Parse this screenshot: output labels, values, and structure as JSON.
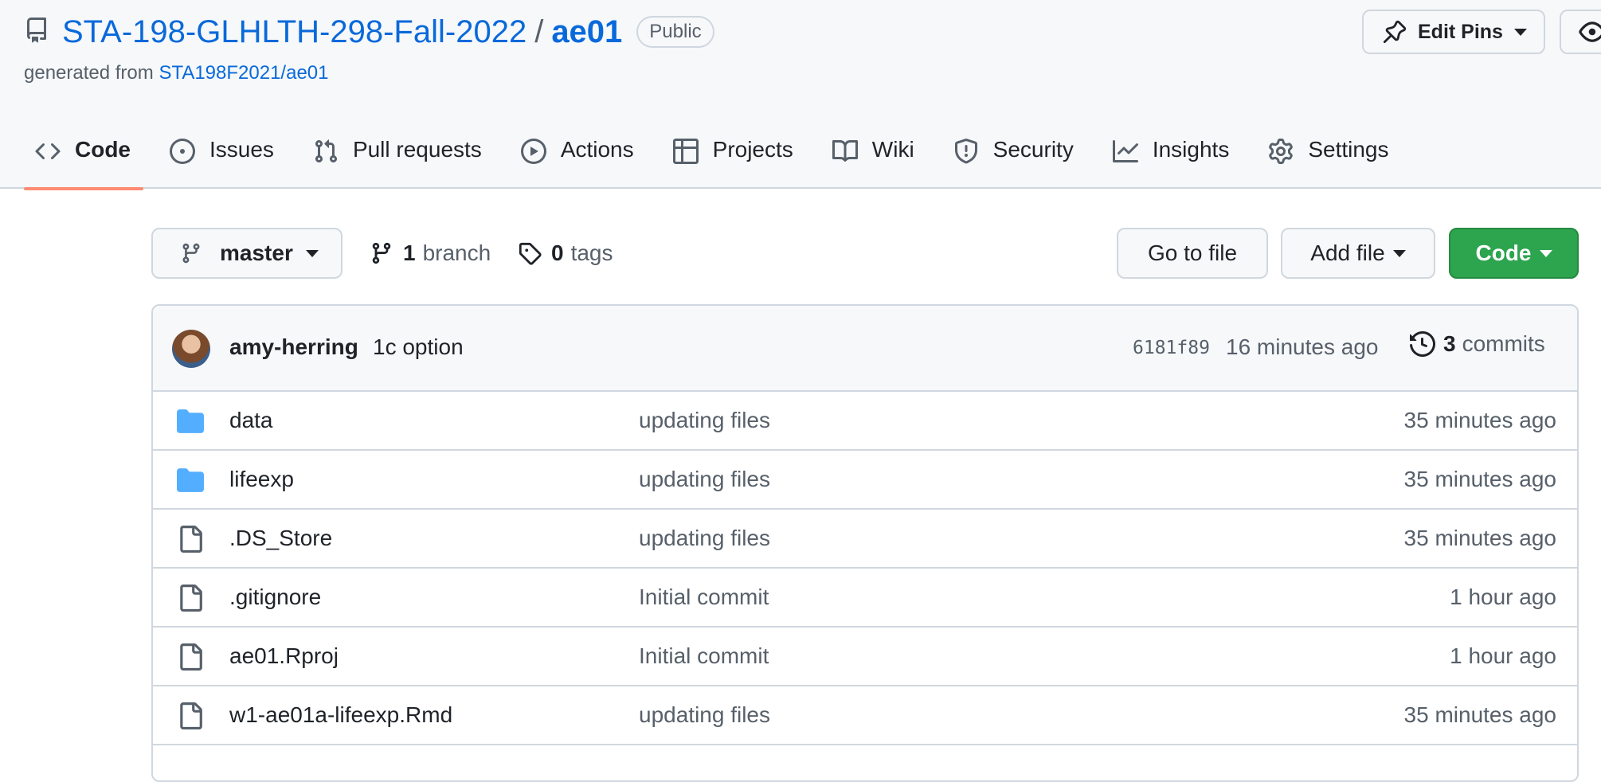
{
  "repo": {
    "owner": "STA-198-GLHLTH-298-Fall-2022",
    "separator": "/",
    "name": "ae01",
    "visibility": "Public",
    "generated_prefix": "generated from",
    "template_link": "STA198F2021/ae01"
  },
  "header_actions": {
    "edit_pins": "Edit Pins"
  },
  "tabs": [
    {
      "label": "Code",
      "icon": "code-icon",
      "active": true
    },
    {
      "label": "Issues",
      "icon": "issue-icon"
    },
    {
      "label": "Pull requests",
      "icon": "pull-request-icon"
    },
    {
      "label": "Actions",
      "icon": "play-icon"
    },
    {
      "label": "Projects",
      "icon": "table-icon"
    },
    {
      "label": "Wiki",
      "icon": "book-icon"
    },
    {
      "label": "Security",
      "icon": "shield-icon"
    },
    {
      "label": "Insights",
      "icon": "graph-icon"
    },
    {
      "label": "Settings",
      "icon": "gear-icon"
    }
  ],
  "toolbar": {
    "branch": "master",
    "branch_count": "1",
    "branch_label": "branch",
    "tag_count": "0",
    "tag_label": "tags",
    "go_to_file": "Go to file",
    "add_file": "Add file",
    "code": "Code"
  },
  "latest_commit": {
    "author": "amy-herring",
    "message": "1c option",
    "sha": "6181f89",
    "time": "16 minutes ago",
    "count": "3",
    "count_label": "commits"
  },
  "files": [
    {
      "type": "folder",
      "icon": "folder-icon",
      "name": "data",
      "commit": "updating files",
      "age": "35 minutes ago"
    },
    {
      "type": "folder",
      "icon": "folder-icon",
      "name": "lifeexp",
      "commit": "updating files",
      "age": "35 minutes ago"
    },
    {
      "type": "file",
      "icon": "file-icon",
      "name": ".DS_Store",
      "commit": "updating files",
      "age": "35 minutes ago"
    },
    {
      "type": "file",
      "icon": "file-icon",
      "name": ".gitignore",
      "commit": "Initial commit",
      "age": "1 hour ago"
    },
    {
      "type": "file",
      "icon": "file-icon",
      "name": "ae01.Rproj",
      "commit": "Initial commit",
      "age": "1 hour ago"
    },
    {
      "type": "file",
      "icon": "file-icon",
      "name": "w1-ae01a-lifeexp.Rmd",
      "commit": "updating files",
      "age": "35 minutes ago"
    }
  ],
  "colors": {
    "link": "#0969da",
    "active_tab_underline": "#fd8c73",
    "primary_button": "#2da44e",
    "folder": "#54aeff"
  }
}
